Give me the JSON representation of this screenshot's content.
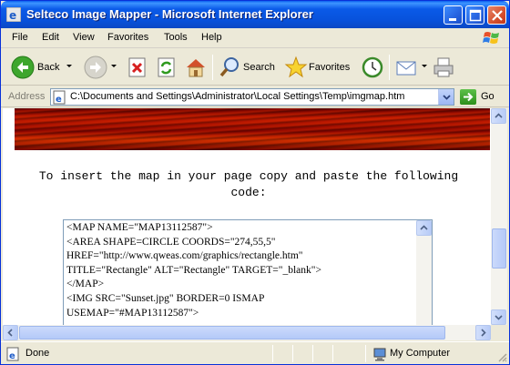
{
  "window": {
    "title": "Selteco Image Mapper - Microsoft Internet Explorer"
  },
  "menu": {
    "items": [
      "File",
      "Edit",
      "View",
      "Favorites",
      "Tools",
      "Help"
    ]
  },
  "toolbar": {
    "back_label": "Back",
    "search_label": "Search",
    "favorites_label": "Favorites"
  },
  "address": {
    "label": "Address",
    "value": "C:\\Documents and Settings\\Administrator\\Local Settings\\Temp\\imgmap.htm",
    "go_label": "Go"
  },
  "page": {
    "instructions": "To insert the map in your page copy and paste the following code:",
    "code_lines": [
      "<MAP NAME=\"MAP13112587\">",
      "<AREA SHAPE=CIRCLE COORDS=\"274,55,5\"",
      "HREF=\"http://www.qweas.com/graphics/rectangle.htm\"",
      "TITLE=\"Rectangle\" ALT=\"Rectangle\" TARGET=\"_blank\">",
      "</MAP>",
      "<IMG SRC=\"Sunset.jpg\" BORDER=0 ISMAP",
      "USEMAP=\"#MAP13112587\">"
    ]
  },
  "status": {
    "text": "Done",
    "zone": "My Computer"
  },
  "colors": {
    "titlebar": "#0A5AE8",
    "chrome": "#ECE9D8",
    "sunset": "#C21A00"
  }
}
